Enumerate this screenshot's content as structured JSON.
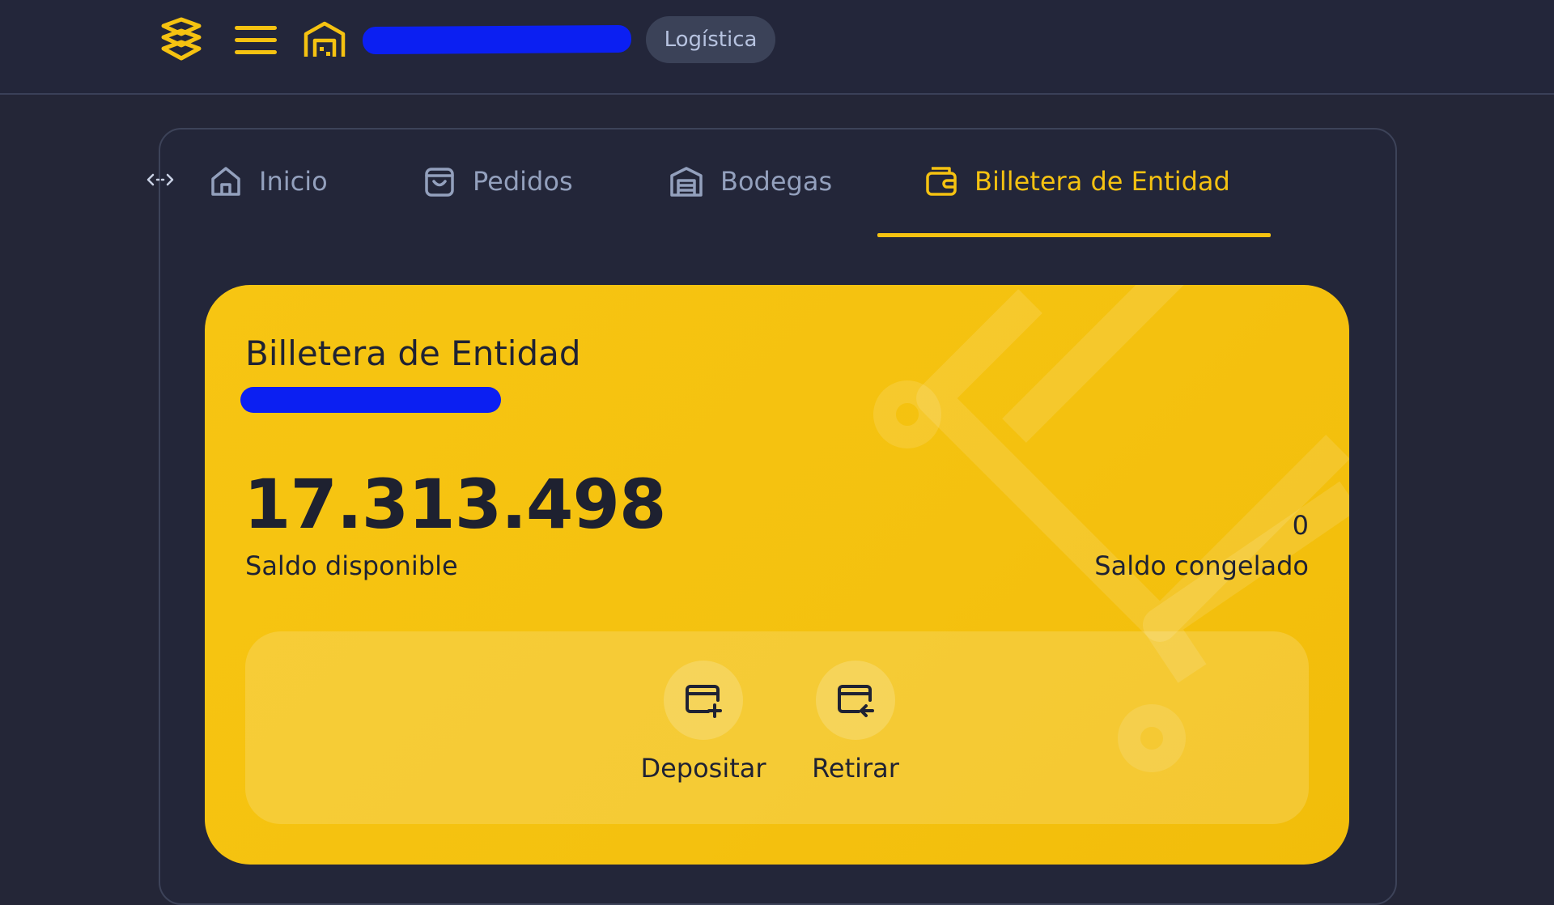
{
  "header": {
    "role_badge": "Logística",
    "colors": {
      "accent": "#f5c211",
      "background": "#242637"
    }
  },
  "tabs": [
    {
      "label": "Inicio",
      "icon": "home-icon",
      "active": false
    },
    {
      "label": "Pedidos",
      "icon": "shopping-bag-icon",
      "active": false
    },
    {
      "label": "Bodegas",
      "icon": "warehouse-icon",
      "active": false
    },
    {
      "label": "Billetera de Entidad",
      "icon": "wallet-icon",
      "active": true
    }
  ],
  "wallet": {
    "title": "Billetera de Entidad",
    "available_balance": "17.313.498",
    "available_label": "Saldo disponible",
    "frozen_balance": "0",
    "frozen_label": "Saldo congelado",
    "actions": [
      {
        "label": "Depositar",
        "icon": "deposit-card-icon"
      },
      {
        "label": "Retirar",
        "icon": "withdraw-card-icon"
      }
    ]
  }
}
